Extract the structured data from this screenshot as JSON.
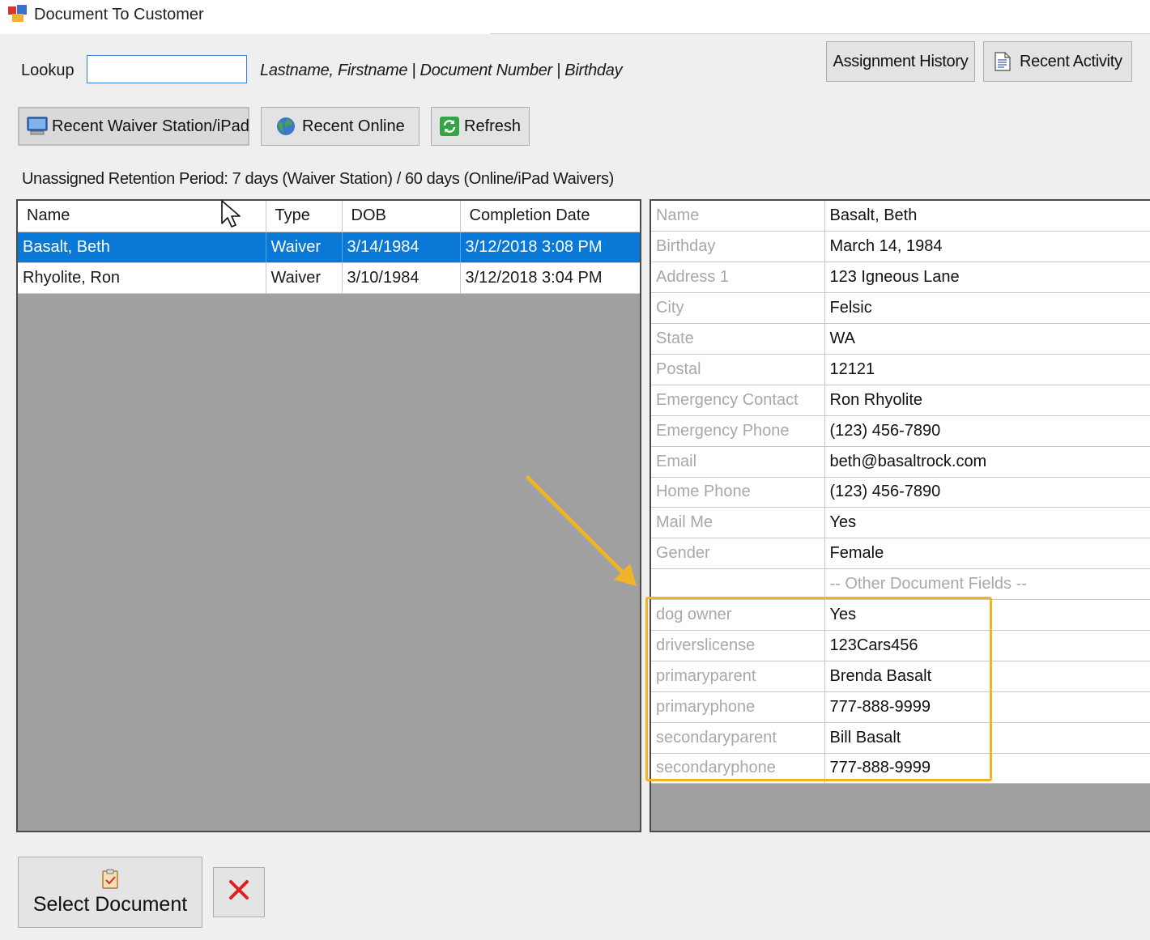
{
  "window": {
    "title": "Document To Customer"
  },
  "lookup": {
    "label": "Lookup",
    "value": "",
    "hint": "Lastname, Firstname  |  Document Number  |  Birthday"
  },
  "toolbar": {
    "assignment_history": "Assignment History",
    "recent_activity": "Recent Activity",
    "recent_waiver_station": "Recent Waiver Station/iPad",
    "recent_online": "Recent Online",
    "refresh": "Refresh"
  },
  "retention_text": "Unassigned Retention Period:  7 days (Waiver Station) / 60 days (Online/iPad Waivers)",
  "documents": {
    "columns": [
      "Name",
      "Type",
      "DOB",
      "Completion Date"
    ],
    "rows": [
      {
        "name": "Basalt, Beth",
        "type": "Waiver",
        "dob": "3/14/1984",
        "completed": "3/12/2018 3:08 PM",
        "selected": true
      },
      {
        "name": "Rhyolite, Ron",
        "type": "Waiver",
        "dob": "3/10/1984",
        "completed": "3/12/2018 3:04 PM",
        "selected": false
      }
    ]
  },
  "details": {
    "fields": [
      {
        "key": "Name",
        "value": "Basalt, Beth"
      },
      {
        "key": "Birthday",
        "value": "March 14, 1984"
      },
      {
        "key": "Address 1",
        "value": "123 Igneous Lane"
      },
      {
        "key": "City",
        "value": "Felsic"
      },
      {
        "key": "State",
        "value": "WA"
      },
      {
        "key": "Postal",
        "value": "12121"
      },
      {
        "key": "Emergency Contact",
        "value": "Ron Rhyolite"
      },
      {
        "key": "Emergency Phone",
        "value": "(123) 456-7890"
      },
      {
        "key": "Email",
        "value": "beth@basaltrock.com"
      },
      {
        "key": "Home Phone",
        "value": "(123) 456-7890"
      },
      {
        "key": "Mail Me",
        "value": "Yes"
      },
      {
        "key": "Gender",
        "value": "Female"
      }
    ],
    "section_label": "-- Other Document Fields --",
    "other_fields": [
      {
        "key": "dog owner",
        "value": "Yes"
      },
      {
        "key": "driverslicense",
        "value": "123Cars456"
      },
      {
        "key": "primaryparent",
        "value": "Brenda Basalt"
      },
      {
        "key": "primaryphone",
        "value": "777-888-9999"
      },
      {
        "key": "secondaryparent",
        "value": "Bill Basalt"
      },
      {
        "key": "secondaryphone",
        "value": "777-888-9999"
      }
    ]
  },
  "actions": {
    "select_document": "Select Document",
    "close_icon": "close-icon"
  },
  "colors": {
    "selection": "#0a78d7",
    "highlight": "#f0b429",
    "grid_background": "#a0a0a0",
    "close_red": "#e02020"
  }
}
